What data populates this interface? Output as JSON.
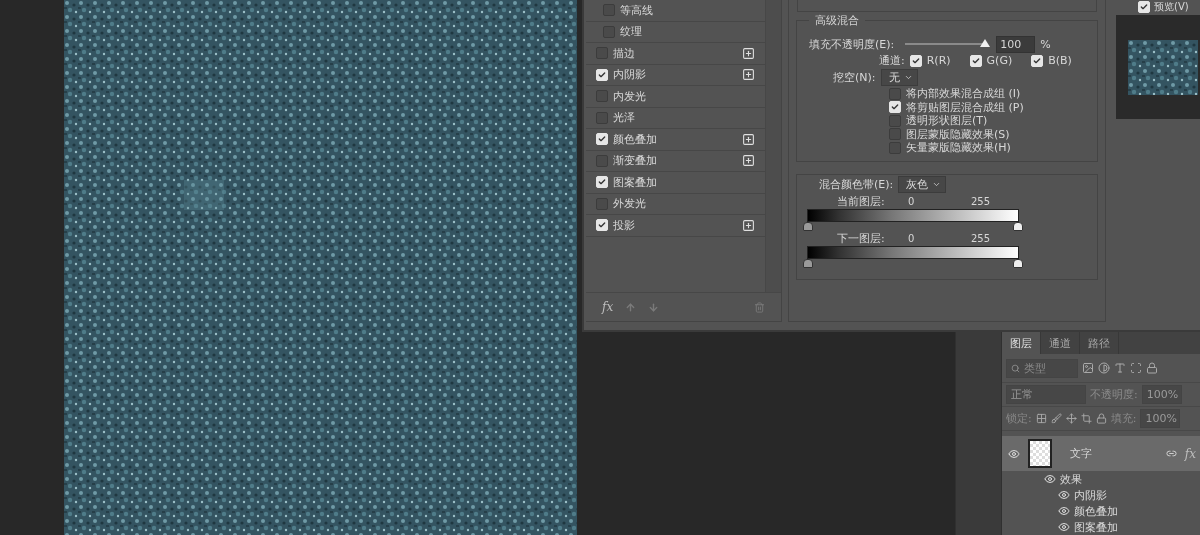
{
  "layer_style": {
    "styles": [
      {
        "label": "等高线",
        "kind": "sub",
        "checked": false,
        "addable": false
      },
      {
        "label": "纹理",
        "kind": "sub",
        "checked": false,
        "addable": false
      },
      {
        "label": "描边",
        "kind": "style",
        "checked": false,
        "addable": true
      },
      {
        "label": "内阴影",
        "kind": "style",
        "checked": true,
        "addable": true
      },
      {
        "label": "内发光",
        "kind": "style",
        "checked": false,
        "addable": false
      },
      {
        "label": "光泽",
        "kind": "style",
        "checked": false,
        "addable": false
      },
      {
        "label": "颜色叠加",
        "kind": "style",
        "checked": true,
        "addable": true
      },
      {
        "label": "渐变叠加",
        "kind": "style",
        "checked": false,
        "addable": true
      },
      {
        "label": "图案叠加",
        "kind": "style",
        "checked": true,
        "addable": false
      },
      {
        "label": "外发光",
        "kind": "style",
        "checked": false,
        "addable": false
      },
      {
        "label": "投影",
        "kind": "style",
        "checked": true,
        "addable": true
      }
    ],
    "fx_label": "fx",
    "advanced_blending": {
      "title": "高级混合",
      "fill_opacity": {
        "label": "填充不透明度(E):",
        "level": 1,
        "value": "100",
        "unit": "%"
      },
      "channels": {
        "label": "通道:",
        "items": [
          {
            "label": "R(R)",
            "checked": true
          },
          {
            "label": "G(G)",
            "checked": true
          },
          {
            "label": "B(B)",
            "checked": true
          }
        ]
      },
      "knockout": {
        "label": "挖空(N):",
        "value": "无"
      },
      "options": [
        {
          "label": "将内部效果混合成组 (I)",
          "checked": false
        },
        {
          "label": "将剪贴图层混合成组 (P)",
          "checked": true
        },
        {
          "label": "透明形状图层(T)",
          "checked": false
        },
        {
          "label": "图层蒙版隐藏效果(S)",
          "checked": false
        },
        {
          "label": "矢量蒙版隐藏效果(H)",
          "checked": false
        }
      ]
    },
    "blend_if": {
      "label": "混合颜色带(E):",
      "value": "灰色",
      "bars": [
        {
          "label": "当前图层:",
          "low": "0",
          "high": "255"
        },
        {
          "label": "下一图层:",
          "low": "0",
          "high": "255"
        }
      ]
    },
    "preview": {
      "label": "预览(V)",
      "checked": true
    }
  },
  "layers_panel": {
    "tabs": [
      {
        "label": "图层",
        "selected": true
      },
      {
        "label": "通道",
        "selected": false
      },
      {
        "label": "路径",
        "selected": false
      }
    ],
    "filter": {
      "placeholder": "类型"
    },
    "blend_mode": "正常",
    "opacity": {
      "label": "不透明度:",
      "value": "100%"
    },
    "lock": {
      "label": "锁定:"
    },
    "fill": {
      "label": "填充:",
      "value": "100%"
    },
    "layers": [
      {
        "name": "文字",
        "selected": true,
        "visible": true,
        "fx": "fx",
        "children": [
          {
            "name": "效果",
            "visible": true,
            "children": [
              {
                "name": "内阴影",
                "visible": true
              },
              {
                "name": "颜色叠加",
                "visible": true
              },
              {
                "name": "图案叠加",
                "visible": true
              }
            ]
          }
        ]
      }
    ]
  }
}
